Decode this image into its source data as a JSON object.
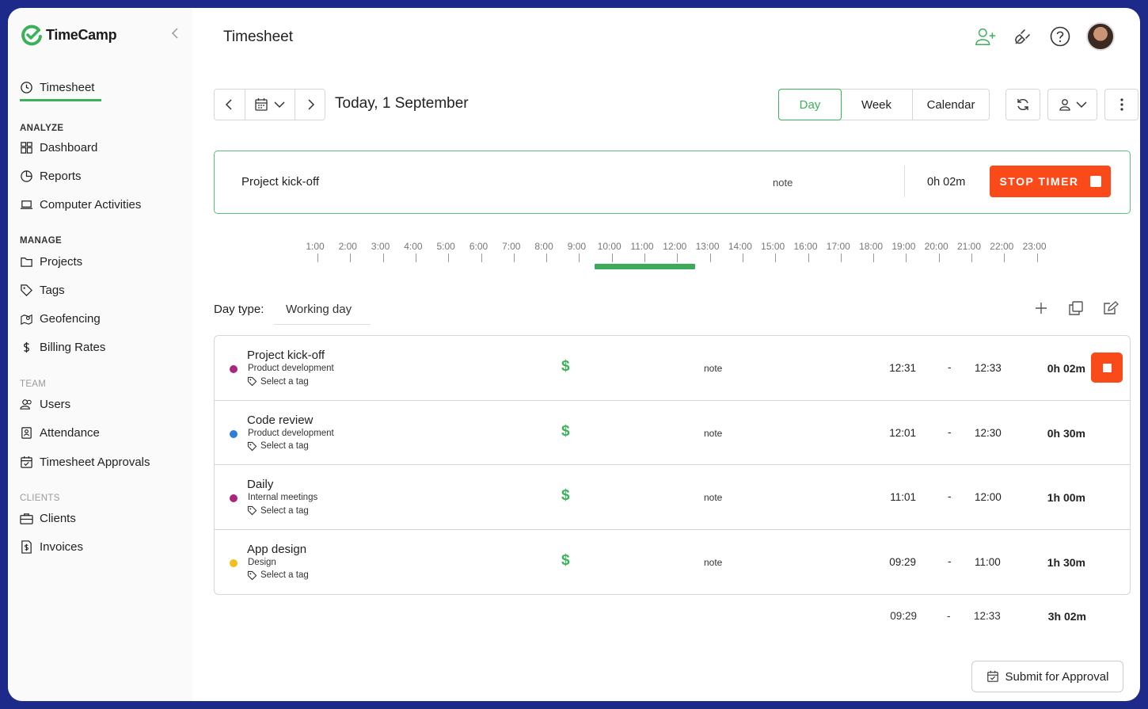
{
  "app": {
    "name": "TimeCamp"
  },
  "sidebar": {
    "active": {
      "label": "Timesheet",
      "icon": "clock-icon"
    },
    "sections": {
      "analyze": "ANALYZE",
      "manage": "MANAGE",
      "team": "TEAM",
      "clients": "CLIENTS"
    },
    "items": {
      "dashboard": "Dashboard",
      "reports": "Reports",
      "computer_activities": "Computer Activities",
      "projects": "Projects",
      "tags": "Tags",
      "geofencing": "Geofencing",
      "billing_rates": "Billing Rates",
      "users": "Users",
      "attendance": "Attendance",
      "timesheet_approvals": "Timesheet Approvals",
      "clients": "Clients",
      "invoices": "Invoices"
    }
  },
  "header": {
    "title": "Timesheet"
  },
  "toolbar": {
    "date_label": "Today, 1 September",
    "views": {
      "day": "Day",
      "week": "Week",
      "calendar": "Calendar"
    },
    "active_view": "Day"
  },
  "timer": {
    "task": "Project kick-off",
    "note": "note",
    "duration": "0h 02m",
    "stop_label": "STOP TIMER"
  },
  "timeline": {
    "hours": [
      "1:00",
      "2:00",
      "3:00",
      "4:00",
      "5:00",
      "6:00",
      "7:00",
      "8:00",
      "9:00",
      "10:00",
      "11:00",
      "12:00",
      "13:00",
      "14:00",
      "15:00",
      "16:00",
      "17:00",
      "18:00",
      "19:00",
      "20:00",
      "21:00",
      "22:00",
      "23:00"
    ],
    "tracked_start": 9.48,
    "tracked_end": 12.55
  },
  "day_type": {
    "label": "Day type:",
    "value": "Working day"
  },
  "entries": [
    {
      "title": "Project kick-off",
      "project": "Product development",
      "color": "#a8267f",
      "tag": "Select a tag",
      "billable": "$",
      "note": "note",
      "start": "12:31",
      "dash": "-",
      "end": "12:33",
      "duration": "0h 02m",
      "running": true
    },
    {
      "title": "Code review",
      "project": "Product development",
      "color": "#2e7dd7",
      "tag": "Select a tag",
      "billable": "$",
      "note": "note",
      "start": "12:01",
      "dash": "-",
      "end": "12:30",
      "duration": "0h 30m",
      "running": false
    },
    {
      "title": "Daily",
      "project": "Internal meetings",
      "color": "#a8267f",
      "tag": "Select a tag",
      "billable": "$",
      "note": "note",
      "start": "11:01",
      "dash": "-",
      "end": "12:00",
      "duration": "1h 00m",
      "running": false
    },
    {
      "title": "App design",
      "project": "Design",
      "color": "#f0c01e",
      "tag": "Select a tag",
      "billable": "$",
      "note": "note",
      "start": "09:29",
      "dash": "-",
      "end": "11:00",
      "duration": "1h 30m",
      "running": false
    }
  ],
  "totals": {
    "start": "09:29",
    "dash": "-",
    "end": "12:33",
    "duration": "3h 02m"
  },
  "footer": {
    "submit_label": "Submit for Approval"
  },
  "colors": {
    "accent": "#3bb25a",
    "stop": "#fa4a1a",
    "frame": "#1e2a8a"
  }
}
